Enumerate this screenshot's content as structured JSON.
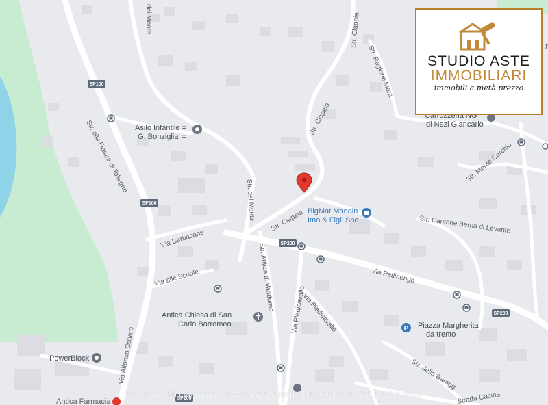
{
  "map": {
    "roads": {
      "del_monte_top": "del Monte",
      "str_ciapeia_top": "Str. Ciapeia",
      "str_regione_mora": "Str. Regione Mora",
      "str_ciapeia_mid": "Str. Ciapeia",
      "str_alla_fiatura": "Str. alla Fiatura di Tollegno",
      "via_barbacane": "Via Barbacane",
      "via_alle_scuole": "Via alle Scuole",
      "str_del_monte": "Str. del Monte",
      "str_ciapeia_low": "Str. Ciapeia",
      "str_antica_vandorno": "Str. Antica di Vandorno",
      "via_piedicavallo_1": "Via Piedicavallo",
      "via_piedicavallo_2": "Via Piedicavallo",
      "via_petlinengo": "Via Petlinengo",
      "str_cantone": "Str. Cantone Berna di Levante",
      "str_monte_cerchio": "Str. Monte Cerchio",
      "via_alfonso_ogliaro": "Via Alfonso Ogliaro",
      "str_della_baraggia": "Str. della Baragg",
      "strada_cacina": "Strada Cacina"
    },
    "badges": {
      "sp100_a": "SP100",
      "sp100_b": "SP100",
      "sp200_a": "SP200",
      "sp200_b": "SP200",
      "sp200_c": "SP200"
    },
    "pois": {
      "asilo_line1": "Asilo Infantile =",
      "asilo_line2": "G. Bonziglia' =",
      "bigmat_line1": "BigMat Mondin",
      "bigmat_line2": "Imo & Figli Snc",
      "carrozzeria_line1": "Carrozzeria NG",
      "carrozzeria_line2": "di Nezi Giancarlo",
      "chiesa_line1": "Antica Chiesa di San",
      "chiesa_line2": "Carlo Borromeo",
      "piazza_line1": "Piazza Margherita",
      "piazza_line2": "da trento",
      "powerblock": "PowerBlock",
      "farmacia": "Antica Farmacia"
    },
    "edge_label": "C.R.",
    "colors": {
      "land": "#e9eaee",
      "road": "#ffffff",
      "water": "#8fd3e8",
      "park": "#c8ecd2",
      "building": "#dcdde2",
      "pin": "#e2382e",
      "transit": "#5f6b7a"
    }
  },
  "logo": {
    "line1": "STUDIO ASTE",
    "line2": "IMMOBILIARI",
    "line3": "immobili a metà prezzo"
  },
  "watermark": "Protected with trial version of Visual Watermark. Full version doesn't put this mark."
}
